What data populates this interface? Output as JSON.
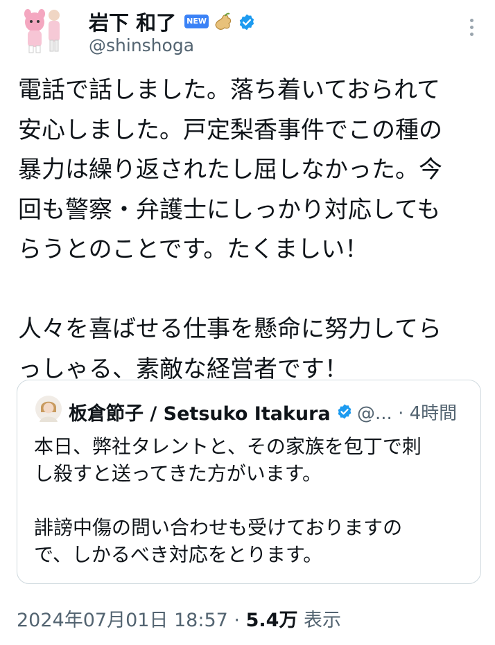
{
  "tweet": {
    "author_name": "岩下 和了",
    "badge_new": "NEW",
    "handle": "@shinshoga",
    "body": "電話で話しました。落ち着いておられて\n安心しました。戸定梨香事件でこの種の\n暴力は繰り返されたし屈しなかった。今\n回も警察・弁護士にしっかり対応しても\nらうとのことです。たくましい！\n\n人々を喜ばせる仕事を懸命に努力してら\nっしゃる、素敵な経営者です！"
  },
  "quote": {
    "author_name": "板倉節子 / Setsuko Itakura",
    "handle": "@...",
    "time": "· 4時間",
    "body": "本日、弊社タレントと、その家族を包丁で刺\nし殺すと送ってきた方がいます。\n\n誹謗中傷の問い合わせも受けておりますの\nで、しかるべき対応をとります。"
  },
  "footer": {
    "timestamp": "2024年07月01日 18:57",
    "separator": "·",
    "views_count": "5.4万",
    "views_label": "表示"
  },
  "colors": {
    "verified": "#1d9bf0",
    "muted_text": "#536471",
    "border": "#cfd9de"
  }
}
